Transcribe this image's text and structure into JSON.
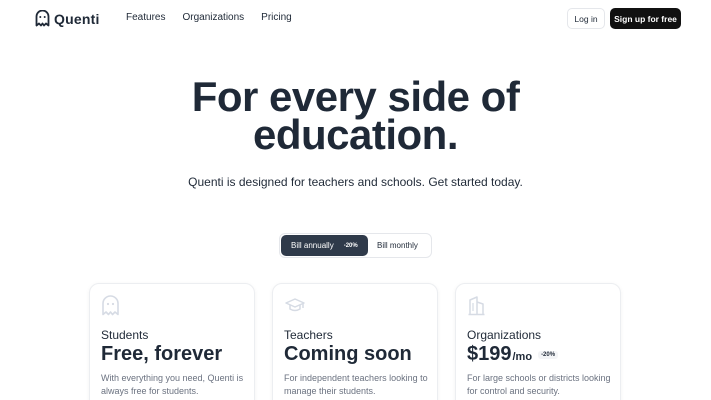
{
  "nav": {
    "brand": "Quenti",
    "links": [
      "Features",
      "Organizations",
      "Pricing"
    ],
    "login_label": "Log in",
    "signup_label": "Sign up for free"
  },
  "hero": {
    "title_line1": "For every side of",
    "title_line2": "education.",
    "subtitle": "Quenti is designed for teachers and schools. Get started today."
  },
  "billing": {
    "annual_label": "Bill annually",
    "annual_badge": "-20%",
    "monthly_label": "Bill monthly",
    "selected": "annual"
  },
  "plans": [
    {
      "icon": "ghost-icon",
      "role": "Students",
      "price": "Free, forever",
      "desc": "With everything you need, Quenti is always free for students."
    },
    {
      "icon": "graduation-cap-icon",
      "role": "Teachers",
      "price": "Coming soon",
      "desc": "For independent teachers looking to manage their students."
    },
    {
      "icon": "building-icon",
      "role": "Organizations",
      "price": "$199",
      "price_suffix": "/mo",
      "price_badge": "-20%",
      "desc": "For large schools or districts looking for control and security."
    }
  ],
  "colors": {
    "accent_dark": "#111111",
    "toggle_active": "#2f3a4a",
    "icon_muted": "#d6dbe4"
  }
}
